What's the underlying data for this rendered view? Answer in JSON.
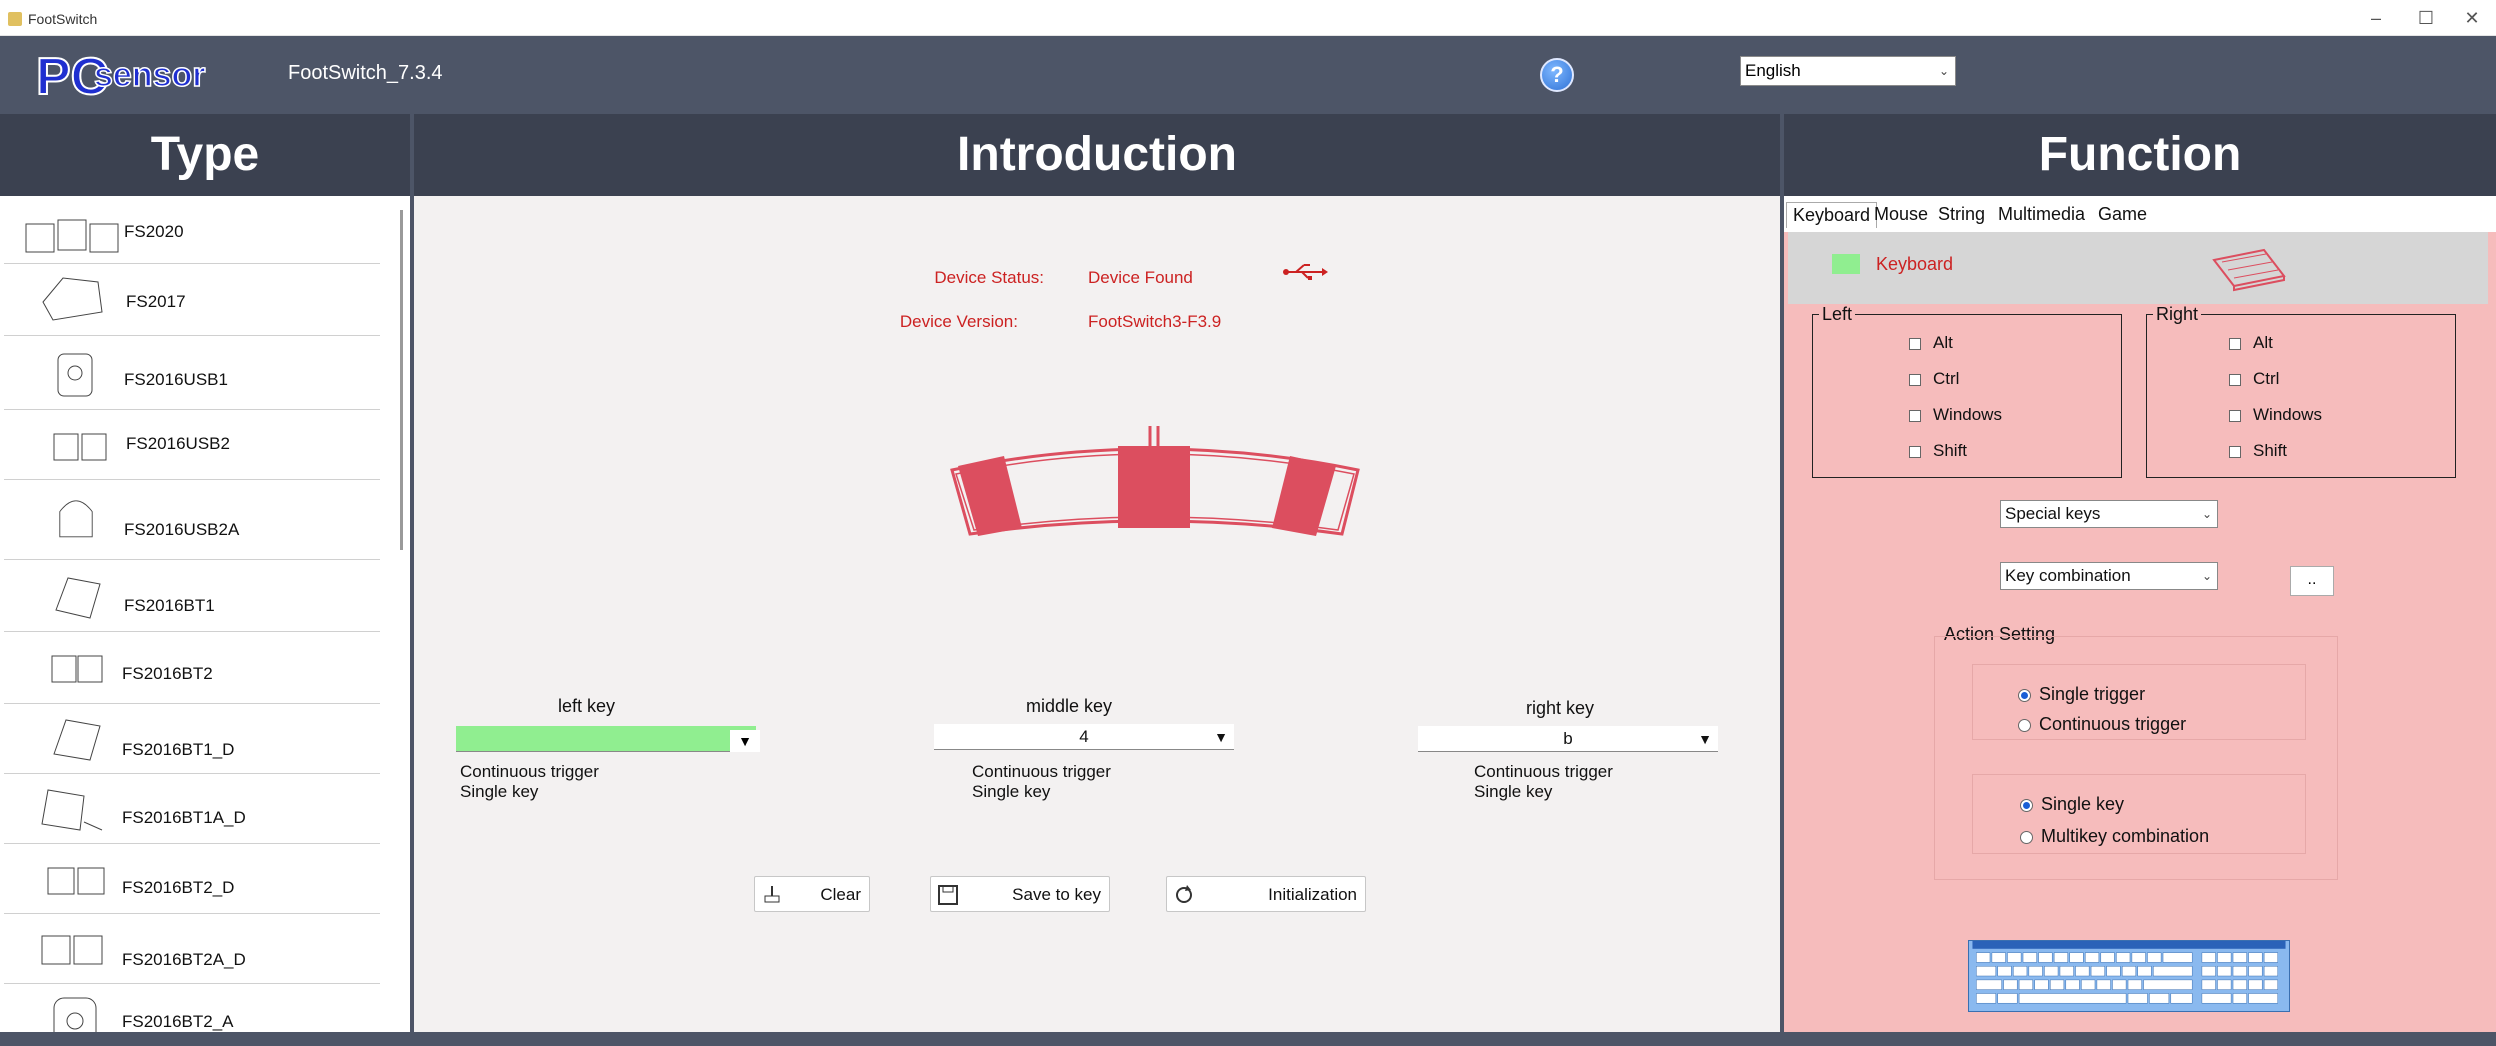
{
  "window": {
    "title": "FootSwitch"
  },
  "header": {
    "logo_text": "PCsensor",
    "version": "FootSwitch_7.3.4",
    "language": "English"
  },
  "columns": {
    "type": "Type",
    "introduction": "Introduction",
    "function": "Function"
  },
  "type_list": [
    {
      "label": "FS2020"
    },
    {
      "label": "FS2017"
    },
    {
      "label": "FS2016USB1"
    },
    {
      "label": "FS2016USB2"
    },
    {
      "label": "FS2016USB2A"
    },
    {
      "label": "FS2016BT1"
    },
    {
      "label": "FS2016BT2"
    },
    {
      "label": "FS2016BT1_D"
    },
    {
      "label": "FS2016BT1A_D"
    },
    {
      "label": "FS2016BT2_D"
    },
    {
      "label": "FS2016BT2A_D"
    },
    {
      "label": "FS2016BT2_A"
    }
  ],
  "intro": {
    "device_status_label": "Device Status:",
    "device_status_value": "Device Found",
    "device_version_label": "Device Version:",
    "device_version_value": "FootSwitch3-F3.9",
    "keys": [
      {
        "label": "left key",
        "value": "",
        "mode1": "Continuous trigger",
        "mode2": "Single key"
      },
      {
        "label": "middle key",
        "value": "4",
        "mode1": "Continuous trigger",
        "mode2": "Single key"
      },
      {
        "label": "right key",
        "value": "b",
        "mode1": "Continuous trigger",
        "mode2": "Single key"
      }
    ],
    "buttons": {
      "clear": "Clear",
      "save": "Save to key",
      "init": "Initialization"
    }
  },
  "function": {
    "tabs": [
      "Keyboard",
      "Mouse",
      "String",
      "Multimedia",
      "Game"
    ],
    "active_tab": "Keyboard",
    "band_label": "Keyboard",
    "left_group": {
      "title": "Left",
      "items": [
        "Alt",
        "Ctrl",
        "Windows",
        "Shift"
      ]
    },
    "right_group": {
      "title": "Right",
      "items": [
        "Alt",
        "Ctrl",
        "Windows",
        "Shift"
      ]
    },
    "special_keys": "Special keys",
    "key_combination": "Key combination",
    "dots_button": "..",
    "action_setting": {
      "title": "Action Setting",
      "trigger_options": [
        "Single trigger",
        "Continuous trigger"
      ],
      "trigger_selected": "Single trigger",
      "key_options": [
        "Single key",
        "Multikey  combination"
      ],
      "key_selected": "Single key"
    }
  },
  "colors": {
    "header_bg": "#4d5567",
    "column_head_bg": "#3b4150",
    "function_bg": "#f6bcbc",
    "status_red": "#cc2222",
    "green_swatch": "#90ee90",
    "pedal_red": "#dc4e5f"
  }
}
